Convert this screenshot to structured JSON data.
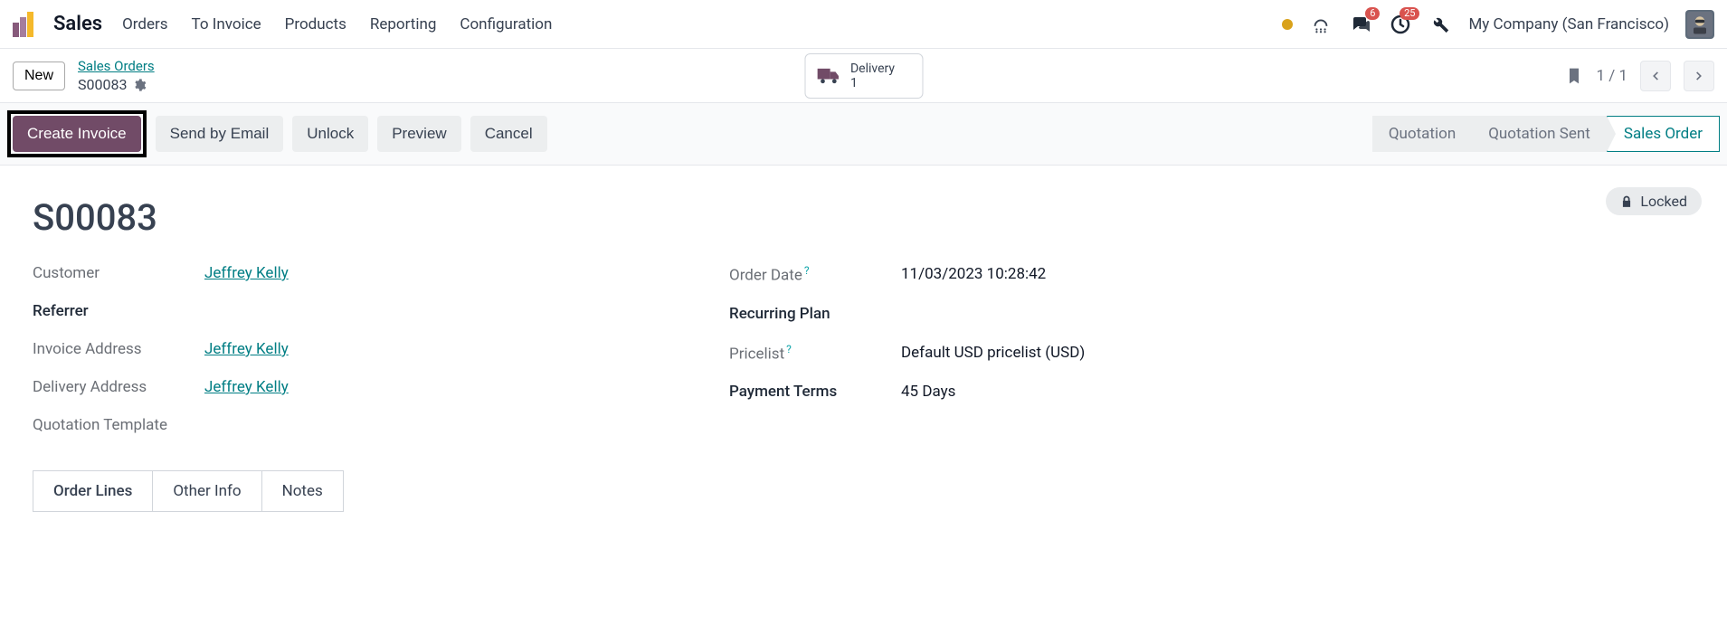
{
  "app": {
    "title": "Sales"
  },
  "topmenu": {
    "orders": "Orders",
    "to_invoice": "To Invoice",
    "products": "Products",
    "reporting": "Reporting",
    "configuration": "Configuration"
  },
  "header": {
    "company": "My Company (San Francisco)",
    "chat_badge": "6",
    "activity_badge": "25"
  },
  "breadcrumb": {
    "new_button": "New",
    "parent_link": "Sales Orders",
    "current": "S00083"
  },
  "delivery_stat": {
    "label": "Delivery",
    "count": "1"
  },
  "pager": {
    "text": "1 / 1"
  },
  "actions": {
    "create_invoice": "Create Invoice",
    "send_email": "Send by Email",
    "unlock": "Unlock",
    "preview": "Preview",
    "cancel": "Cancel"
  },
  "status_steps": {
    "quotation": "Quotation",
    "quotation_sent": "Quotation Sent",
    "sales_order": "Sales Order"
  },
  "locked_badge": "Locked",
  "record": {
    "title": "S00083",
    "fields": {
      "customer_label": "Customer",
      "customer_value": "Jeffrey Kelly",
      "referrer_label": "Referrer",
      "invoice_addr_label": "Invoice Address",
      "invoice_addr_value": "Jeffrey Kelly",
      "delivery_addr_label": "Delivery Address",
      "delivery_addr_value": "Jeffrey Kelly",
      "quote_tmpl_label": "Quotation Template",
      "order_date_label": "Order Date",
      "order_date_value": "11/03/2023 10:28:42",
      "recurring_plan_label": "Recurring Plan",
      "pricelist_label": "Pricelist",
      "pricelist_value": "Default USD pricelist (USD)",
      "payment_terms_label": "Payment Terms",
      "payment_terms_value": "45 Days"
    }
  },
  "tabs": {
    "order_lines": "Order Lines",
    "other_info": "Other Info",
    "notes": "Notes"
  }
}
